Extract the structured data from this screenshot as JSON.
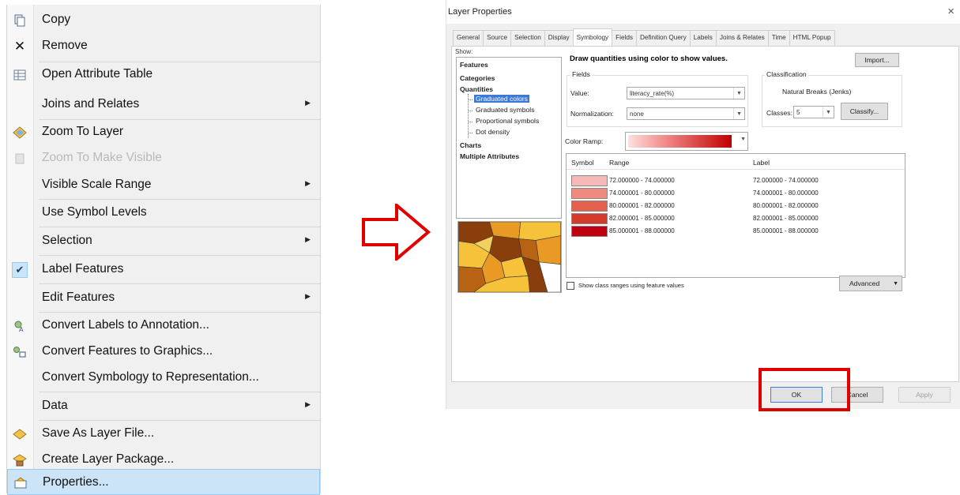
{
  "context_menu": {
    "items": [
      {
        "label": "Copy",
        "icon": "copy-icon",
        "submenu": false,
        "state": "normal"
      },
      {
        "label": "Remove",
        "icon": "remove-icon",
        "submenu": false,
        "state": "normal"
      },
      {
        "label": "Open Attribute Table",
        "icon": "table-icon",
        "submenu": false,
        "state": "normal"
      },
      {
        "label": "Joins and Relates",
        "icon": "",
        "submenu": true,
        "state": "normal"
      },
      {
        "label": "Zoom To Layer",
        "icon": "zoom-layer-icon",
        "submenu": false,
        "state": "normal"
      },
      {
        "label": "Zoom To Make Visible",
        "icon": "zoom-visible-icon",
        "submenu": false,
        "state": "disabled"
      },
      {
        "label": "Visible Scale Range",
        "icon": "",
        "submenu": true,
        "state": "normal"
      },
      {
        "label": "Use Symbol Levels",
        "icon": "",
        "submenu": false,
        "state": "normal"
      },
      {
        "label": "Selection",
        "icon": "",
        "submenu": true,
        "state": "normal"
      },
      {
        "label": "Label Features",
        "icon": "check-icon",
        "submenu": false,
        "state": "checked"
      },
      {
        "label": "Edit Features",
        "icon": "",
        "submenu": true,
        "state": "normal"
      },
      {
        "label": "Convert Labels to Annotation...",
        "icon": "annotation-icon",
        "submenu": false,
        "state": "normal"
      },
      {
        "label": "Convert Features to Graphics...",
        "icon": "graphics-icon",
        "submenu": false,
        "state": "normal"
      },
      {
        "label": "Convert Symbology to Representation...",
        "icon": "",
        "submenu": false,
        "state": "normal"
      },
      {
        "label": "Data",
        "icon": "",
        "submenu": true,
        "state": "normal"
      },
      {
        "label": "Save As Layer File...",
        "icon": "layer-file-icon",
        "submenu": false,
        "state": "normal"
      },
      {
        "label": "Create Layer Package...",
        "icon": "layer-package-icon",
        "submenu": false,
        "state": "normal"
      },
      {
        "label": "Properties...",
        "icon": "properties-icon",
        "submenu": false,
        "state": "selected"
      }
    ]
  },
  "dialog": {
    "title": "Layer Properties",
    "close_glyph": "×",
    "tabs": [
      "General",
      "Source",
      "Selection",
      "Display",
      "Symbology",
      "Fields",
      "Definition Query",
      "Labels",
      "Joins & Relates",
      "Time",
      "HTML Popup"
    ],
    "active_tab": "Symbology",
    "show_label": "Show:",
    "show_list": {
      "features": "Features",
      "categories": "Categories",
      "quantities": "Quantities",
      "graduated_colors": "Graduated colors",
      "graduated_symbols": "Graduated symbols",
      "proportional_symbols": "Proportional symbols",
      "dot_density": "Dot density",
      "charts": "Charts",
      "multiple_attributes": "Multiple Attributes"
    },
    "main_title": "Draw quantities using color to show values.",
    "import_button": "Import...",
    "fields": {
      "group_label": "Fields",
      "value_label": "Value:",
      "value": "literacy_rate(%)",
      "normalization_label": "Normalization:",
      "normalization": "none"
    },
    "classification": {
      "group_label": "Classification",
      "method": "Natural Breaks (Jenks)",
      "classes_label": "Classes:",
      "classes": "5",
      "classify_button": "Classify..."
    },
    "color_ramp_label": "Color Ramp:",
    "table": {
      "col_symbol": "Symbol",
      "col_range": "Range",
      "col_label": "Label",
      "rows": [
        {
          "color": "#f7b8b8",
          "range": "72.000000 - 74.000000",
          "label": "72.000000 - 74.000000"
        },
        {
          "color": "#ef8a7e",
          "range": "74.000001 - 80.000000",
          "label": "74.000001 - 80.000000"
        },
        {
          "color": "#e5604d",
          "range": "80.000001 - 82.000000",
          "label": "80.000001 - 82.000000"
        },
        {
          "color": "#d63a2a",
          "range": "82.000001 - 85.000000",
          "label": "82.000001 - 85.000000"
        },
        {
          "color": "#c00010",
          "range": "85.000001 - 88.000000",
          "label": "85.000001 - 88.000000"
        }
      ]
    },
    "show_class_ranges": "Show class ranges using feature values",
    "advanced_button": "Advanced",
    "ok_button": "OK",
    "cancel_button": "Cancel",
    "apply_button": "Apply"
  }
}
